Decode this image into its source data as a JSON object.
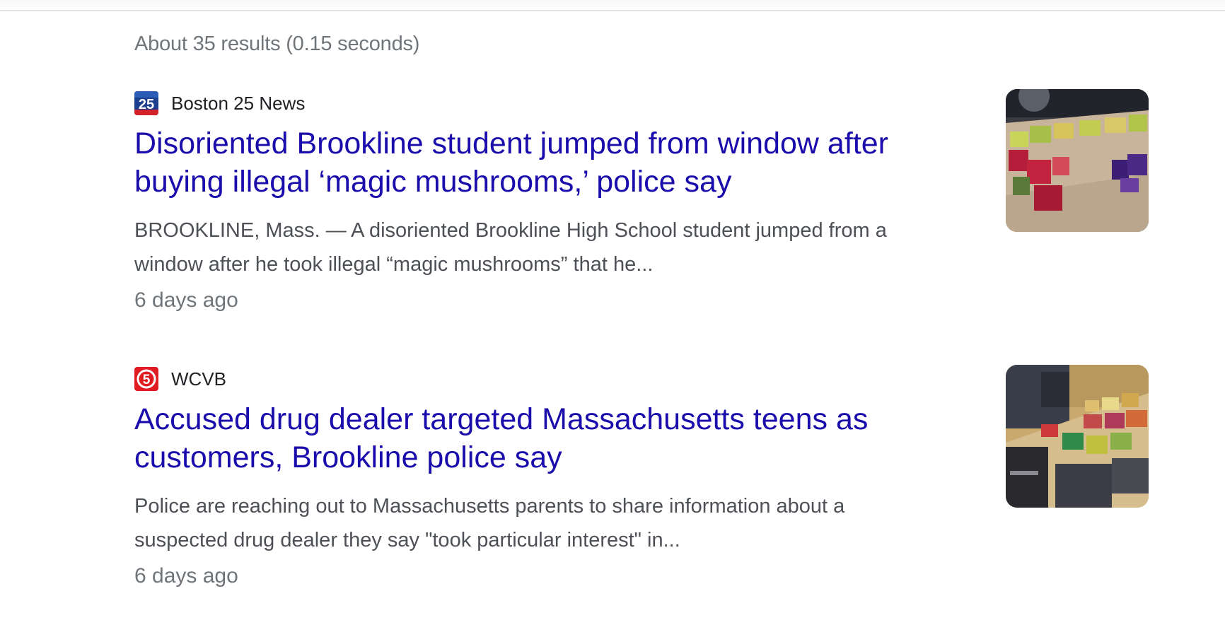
{
  "results_stats": "About 35 results (0.15 seconds)",
  "results": [
    {
      "source": "Boston 25 News",
      "favicon": "boston-25-news-logo",
      "favicon_text": "25",
      "title": "Disoriented Brookline student jumped from window after buying illegal ‘magic mushrooms,’ police say",
      "snippet": "BROOKLINE, Mass. — A disoriented Brookline High School student jumped from a window after he took illegal “magic mushrooms” that he...",
      "date": "6 days ago",
      "thumbnail": "table-with-drug-packages-photo"
    },
    {
      "source": "WCVB",
      "favicon": "wcvb-channel-5-logo",
      "favicon_text": "5",
      "title": "Accused drug dealer targeted Massachusetts teens as customers, Brookline police say",
      "snippet": "Police are reaching out to Massachusetts parents to share information about a suspected drug dealer they say \"took particular interest\" in...",
      "date": "6 days ago",
      "thumbnail": "seized-drug-packages-on-table-photo"
    }
  ],
  "colors": {
    "link": "#1a0dab",
    "snippet": "#4d5156",
    "meta": "#70757a",
    "source": "#202124"
  }
}
